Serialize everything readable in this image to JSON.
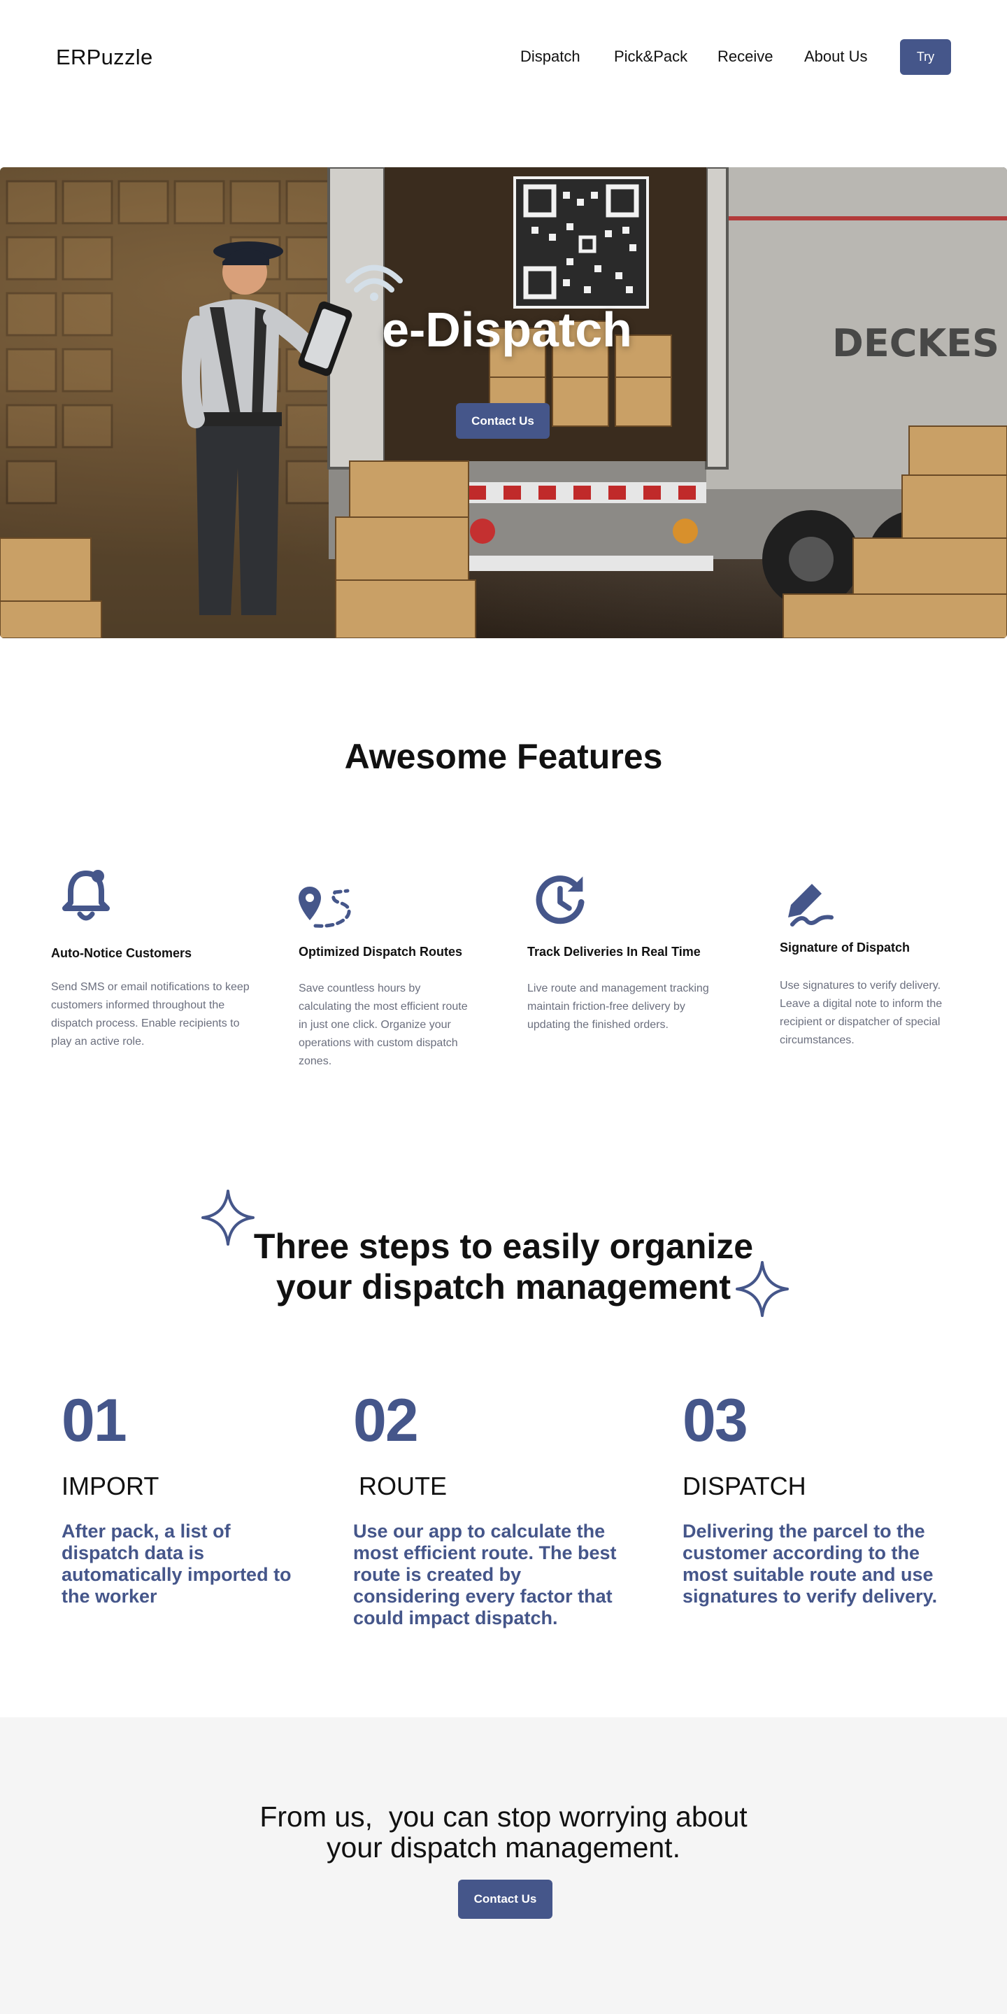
{
  "header": {
    "brand": "ERPuzzle",
    "nav": [
      "Dispatch",
      "Pick&Pack",
      "Receive",
      "About Us"
    ],
    "try_label": "Try"
  },
  "hero": {
    "title": "e-Dispatch",
    "button_label": "Contact Us",
    "truck_text": "DECKES"
  },
  "features": {
    "title": "Awesome Features",
    "items": [
      {
        "icon": "bell-icon",
        "title": "Auto-Notice Customers",
        "description": "Send SMS or email notifications to keep customers informed throughout the dispatch process. Enable recipients to play an active role."
      },
      {
        "icon": "route-pin-icon",
        "title": "Optimized Dispatch Routes",
        "description": "Save countless hours by calculating the most efficient route in just one click. Organize your operations with custom dispatch zones."
      },
      {
        "icon": "clock-refresh-icon",
        "title": "Track Deliveries In Real Time",
        "description": "Live route and management tracking maintain friction-free delivery by updating the finished orders."
      },
      {
        "icon": "signature-pen-icon",
        "title": "Signature of Dispatch",
        "description": "Use signatures to verify delivery. Leave a digital note to inform the recipient or dispatcher of special circumstances."
      }
    ]
  },
  "steps": {
    "title_line1": "Three steps to easily organize",
    "title_line2": "your dispatch management",
    "items": [
      {
        "number": "01",
        "label": "IMPORT",
        "description": "After pack, a list of dispatch data is automatically imported to the worker"
      },
      {
        "number": "02",
        "label": "ROUTE",
        "description": "Use our app to calculate the most efficient route. The best route is created by considering every factor that could impact dispatch."
      },
      {
        "number": "03",
        "label": "DISPATCH",
        "description": "Delivering the parcel to the customer according to the most suitable route and use signatures to verify delivery."
      }
    ]
  },
  "cta": {
    "title_line1": "From us,  you can stop worrying about",
    "title_line2": "your dispatch management.",
    "button_label": "Contact Us"
  },
  "colors": {
    "accent": "#45568a",
    "muted_text": "#6b6f7e",
    "cta_background": "#f5f5f5"
  }
}
